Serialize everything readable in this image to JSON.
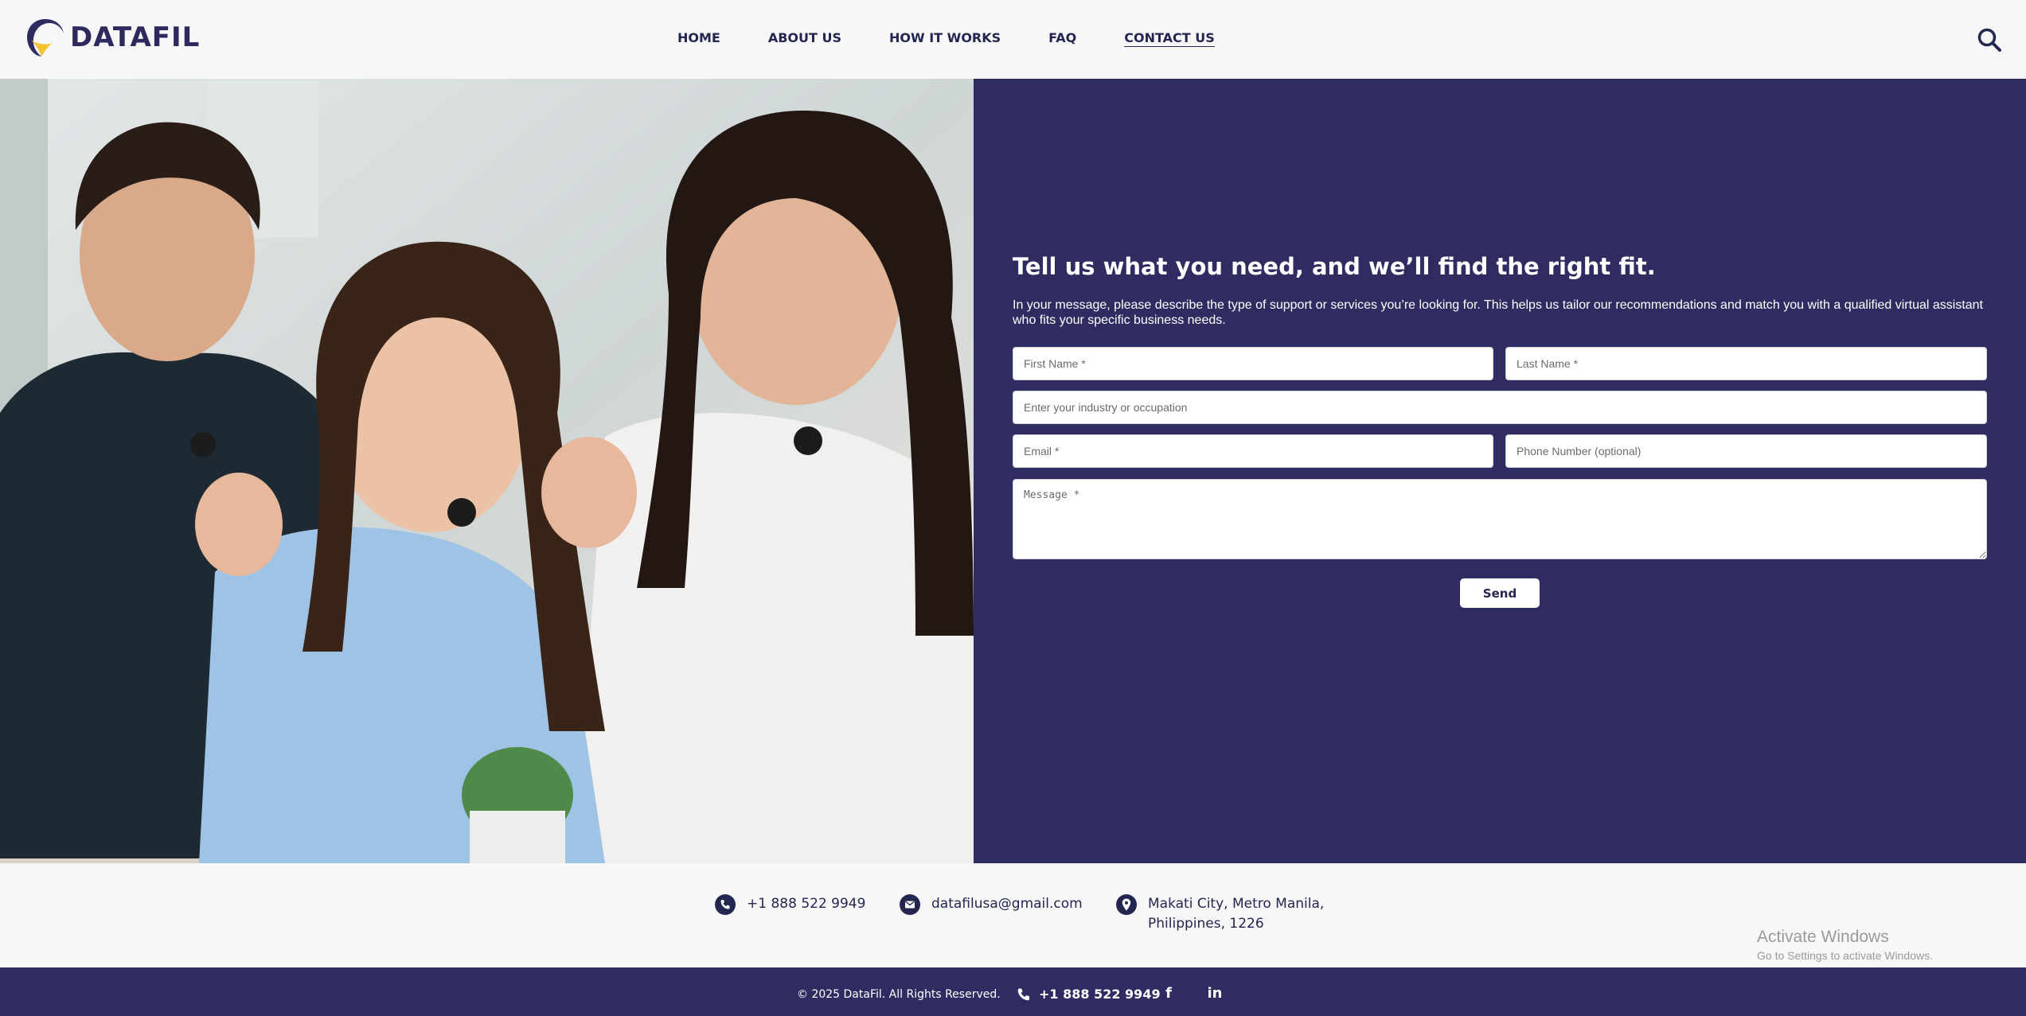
{
  "header": {
    "logo_text": "DATAFIL",
    "nav": [
      "HOME",
      "ABOUT US",
      "HOW IT WORKS",
      "FAQ",
      "CONTACT US"
    ],
    "active_nav": "CONTACT US"
  },
  "form": {
    "heading": "Tell us what you need, and we’ll find the right fit.",
    "description": "In your message, please describe the type of support or services you’re looking for. This helps us tailor our recommendations and match you with a qualified virtual assistant who fits your specific business needs.",
    "first_name_placeholder": "First Name *",
    "last_name_placeholder": "Last Name *",
    "industry_placeholder": "Enter your industry or occupation",
    "email_placeholder": "Email *",
    "phone_placeholder": "Phone Number (optional)",
    "message_placeholder": "Message *",
    "send_label": "Send"
  },
  "contacts": {
    "phone": "+1 888 522 9949",
    "email": "datafilusa@gmail.com",
    "address_line1": "Makati City, Metro Manila,",
    "address_line2": "Philippines, 1226"
  },
  "windows_notice": {
    "title": "Activate Windows",
    "subtitle": "Go to Settings to activate Windows."
  },
  "footer": {
    "copyright": "© 2025 DataFil. All Rights Reserved.",
    "phone": "+1 888 522 9949",
    "facebook_glyph": "f",
    "linkedin_glyph": "in"
  },
  "colors": {
    "primary_navy": "#2e2c61",
    "logo_yellow": "#f2c230",
    "background": "#f7f7f7"
  },
  "icons": [
    "logo-swoosh-icon",
    "search-icon",
    "phone-icon",
    "mail-icon",
    "location-pin-icon",
    "facebook-icon",
    "linkedin-icon"
  ]
}
